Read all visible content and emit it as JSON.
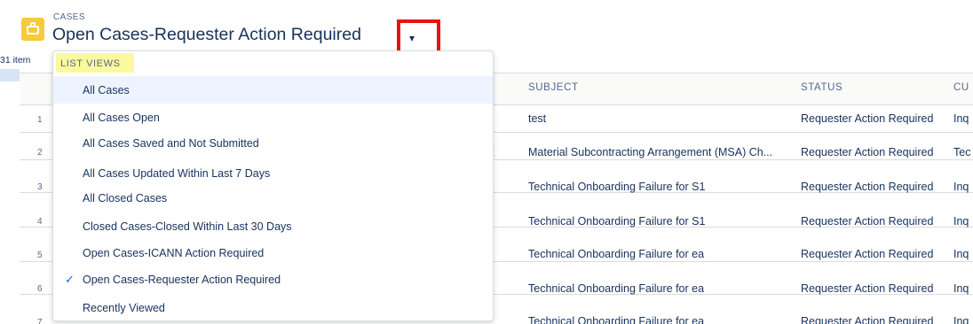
{
  "header": {
    "object_label": "CASES",
    "list_title": "Open Cases-Requester Action Required",
    "caret": "▾",
    "item_count": "31 item"
  },
  "table": {
    "columns": [
      "SUBJECT",
      "STATUS",
      "CU"
    ],
    "row_numbers": [
      "1",
      "2",
      "3",
      "4",
      "5",
      "6",
      "7"
    ],
    "rows": [
      {
        "subject": "test",
        "status": "Requester Action Required",
        "cu": "Inq"
      },
      {
        "subject": "Material Subcontracting Arrangement (MSA) Ch...",
        "status": "Requester Action Required",
        "cu": "Tec",
        "extra": "t"
      },
      {
        "subject": "Technical Onboarding Failure for S1",
        "status": "Requester Action Required",
        "cu": "Inq"
      },
      {
        "subject": "Technical Onboarding Failure for S1",
        "status": "Requester Action Required",
        "cu": "Inq"
      },
      {
        "subject": "Technical Onboarding Failure for ea",
        "status": "Requester Action Required",
        "cu": "Inq"
      },
      {
        "subject": "Technical Onboarding Failure for ea",
        "status": "Requester Action Required",
        "cu": "Inq"
      },
      {
        "subject": "Technical Onboarding Failure for ea",
        "status": "Requester Action Required",
        "cu": "Inq"
      }
    ]
  },
  "dropdown": {
    "heading": "LIST VIEWS",
    "items": [
      "All Cases",
      "All Cases Open",
      "All Cases Saved and Not Submitted",
      "All Cases Updated Within Last 7 Days",
      "All Closed Cases",
      "Closed Cases-Closed Within Last 30 Days",
      "Open Cases-ICANN Action Required",
      "Open Cases-Requester Action Required",
      "Recently Viewed"
    ],
    "check_glyph": "✓"
  },
  "colors": {
    "accent": "#0070d2",
    "highlight_box": "#e8140c",
    "heading_highlight": "#fcf89e",
    "case_icon": "#f5ca3b"
  }
}
